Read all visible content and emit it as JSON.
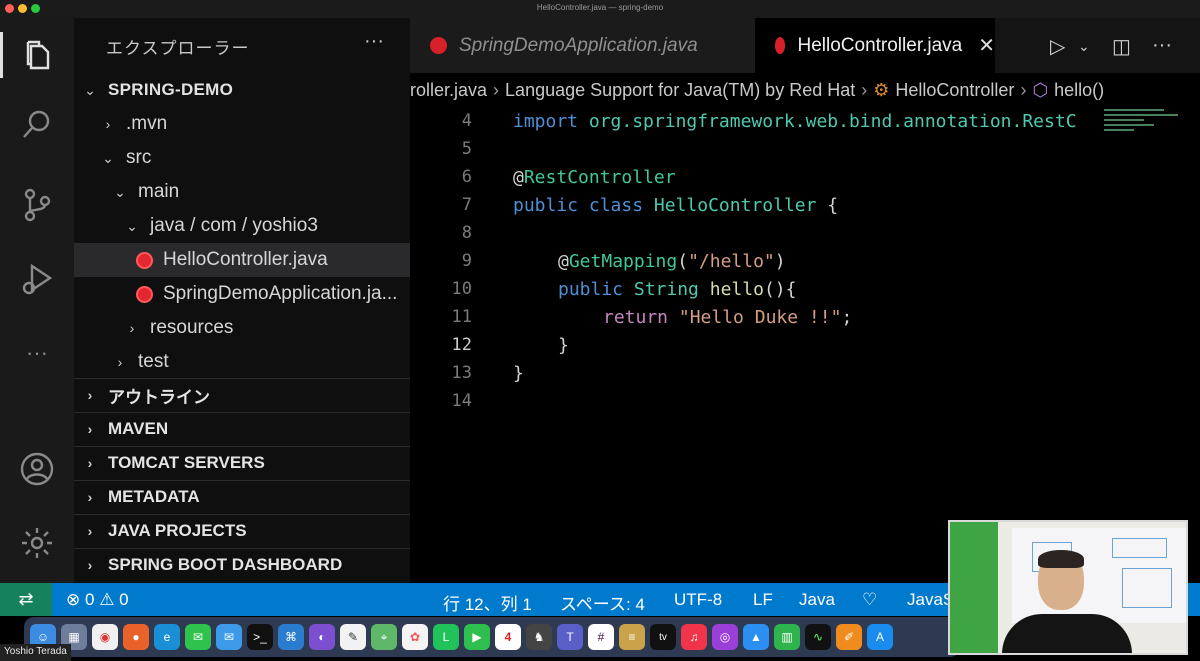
{
  "window": {
    "title": "HelloController.java — spring-demo"
  },
  "explorer": {
    "header": "エクスプローラー",
    "more": "···",
    "project": "SPRING-DEMO",
    "tree": [
      {
        "label": ".mvn"
      },
      {
        "label": "src"
      },
      {
        "label": "main"
      },
      {
        "label": "java / com / yoshio3"
      },
      {
        "label": "HelloController.java"
      },
      {
        "label": "SpringDemoApplication.ja..."
      },
      {
        "label": "resources"
      },
      {
        "label": "test"
      }
    ],
    "sections": [
      "アウトライン",
      "MAVEN",
      "TOMCAT SERVERS",
      "METADATA",
      "JAVA PROJECTS",
      "SPRING BOOT DASHBOARD"
    ]
  },
  "tabs": [
    {
      "label": "SpringDemoApplication.java"
    },
    {
      "label": "HelloController.java",
      "close": "✕"
    }
  ],
  "breadcrumb": {
    "file": "roller.java",
    "ext": "Language Support for Java(TM) by Red Hat",
    "cls": "HelloController",
    "method": "hello()"
  },
  "editor": {
    "line_numbers": [
      "4",
      "5",
      "6",
      "7",
      "8",
      "9",
      "10",
      "11",
      "12",
      "13",
      "14"
    ],
    "current_line": "12",
    "code": {
      "l4_kw": "import",
      "l4_rest": " org.springframework.web.bind.annotation.RestC",
      "l6_at": "@",
      "l6_ann": "RestController",
      "l7_kw1": "public",
      "l7_kw2": "class",
      "l7_name": "HelloController",
      "l7_brace": " {",
      "l9_at": "@",
      "l9_ann": "GetMapping",
      "l9_open": "(",
      "l9_str": "\"/hello\"",
      "l9_close": ")",
      "l10_kw": "public",
      "l10_type": "String",
      "l10_fn": "hello",
      "l10_rest": "(){",
      "l11_kw": "return",
      "l11_str": "\"Hello Duke !!\"",
      "l11_end": ";",
      "l12": "}",
      "l13": "}"
    }
  },
  "status": {
    "errors": "0",
    "warnings": "0",
    "position": "行 12、列 1",
    "spaces": "スペース: 4",
    "encoding": "UTF-8",
    "eol": "LF",
    "language": "Java",
    "extra": "JavaS"
  },
  "dock": {
    "apps": [
      "finder",
      "launchpad",
      "chrome",
      "firefox",
      "edge",
      "messages",
      "mail",
      "terminal",
      "vscode",
      "github",
      "textedit",
      "maps",
      "photos",
      "line",
      "facetime",
      "calendar",
      "reader",
      "teams",
      "slack",
      "notes",
      "tv",
      "music",
      "podcasts",
      "keynote",
      "numbers",
      "activity",
      "pages",
      "appstore"
    ],
    "calendar_day": "4",
    "tv_label": "tv"
  },
  "presenter": {
    "name": "Yoshio Terada"
  },
  "colors": {
    "statusbar": "#007acc",
    "remote": "#16825d",
    "java_icon": "#e3262f",
    "keyword": "#4f8fd6",
    "annotation": "#3ec99a",
    "string": "#d69d85"
  }
}
